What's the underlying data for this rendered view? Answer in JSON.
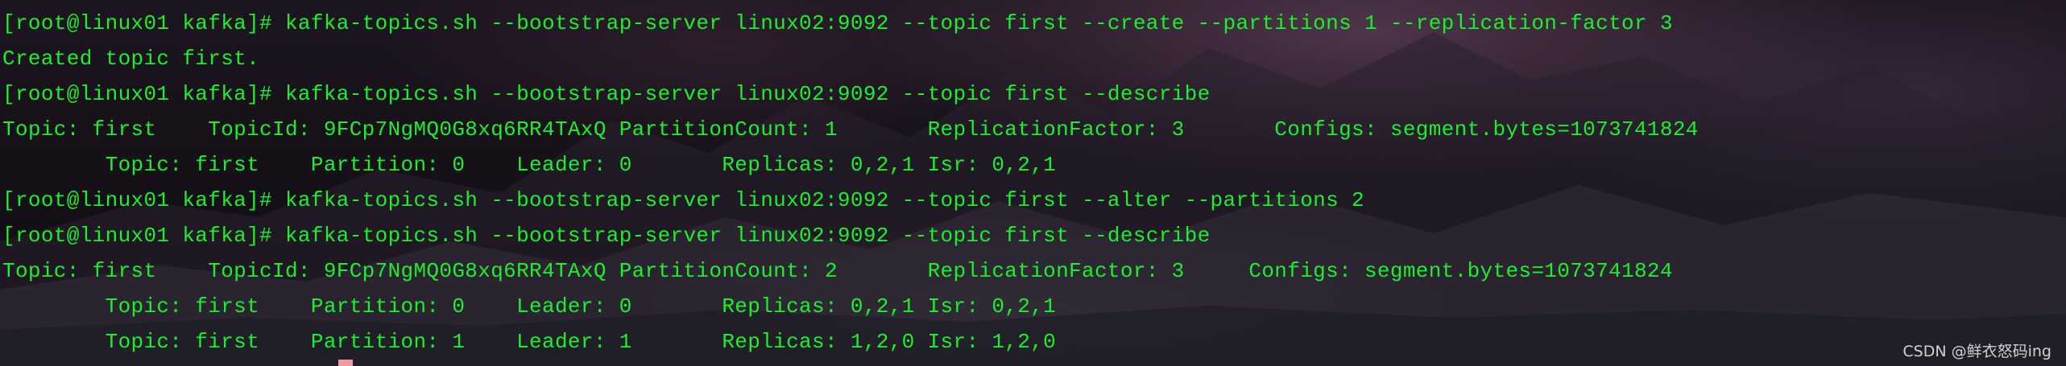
{
  "terminal": {
    "lines": [
      "[root@linux01 kafka]# kafka-topics.sh --bootstrap-server linux02:9092 --topic first --create --partitions 1 --replication-factor 3",
      "Created topic first.",
      "[root@linux01 kafka]# kafka-topics.sh --bootstrap-server linux02:9092 --topic first --describe",
      "Topic: first    TopicId: 9FCp7NgMQ0G8xq6RR4TAxQ PartitionCount: 1       ReplicationFactor: 3       Configs: segment.bytes=1073741824",
      "        Topic: first    Partition: 0    Leader: 0       Replicas: 0,2,1 Isr: 0,2,1",
      "[root@linux01 kafka]# kafka-topics.sh --bootstrap-server linux02:9092 --topic first --alter --partitions 2",
      "[root@linux01 kafka]# kafka-topics.sh --bootstrap-server linux02:9092 --topic first --describe",
      "Topic: first    TopicId: 9FCp7NgMQ0G8xq6RR4TAxQ PartitionCount: 2       ReplicationFactor: 3     Configs: segment.bytes=1073741824",
      "        Topic: first    Partition: 0    Leader: 0       Replicas: 0,2,1 Isr: 0,2,1",
      "        Topic: first    Partition: 1    Leader: 1       Replicas: 1,2,0 Isr: 1,2,0"
    ],
    "text_color": "#1cf02c"
  },
  "watermark": {
    "text": "CSDN @鲜衣怒码ing"
  }
}
